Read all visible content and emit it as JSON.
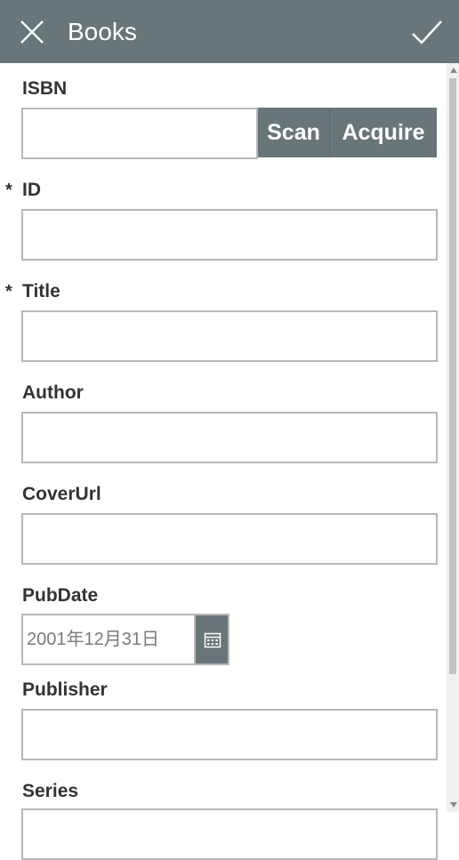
{
  "header": {
    "title": "Books"
  },
  "form": {
    "isbn": {
      "label": "ISBN",
      "value": "",
      "scan_label": "Scan",
      "acquire_label": "Acquire"
    },
    "id": {
      "label": "ID",
      "required_mark": "*",
      "value": ""
    },
    "title": {
      "label": "Title",
      "required_mark": "*",
      "value": ""
    },
    "author": {
      "label": "Author",
      "value": ""
    },
    "coverurl": {
      "label": "CoverUrl",
      "value": ""
    },
    "pubdate": {
      "label": "PubDate",
      "placeholder": "2001年12月31日"
    },
    "publisher": {
      "label": "Publisher",
      "value": ""
    },
    "series": {
      "label": "Series",
      "value": ""
    }
  },
  "colors": {
    "header_bg": "#68767a",
    "accent": "#68767a",
    "input_border": "#b8b8b8"
  },
  "icons": {
    "close": "close-icon",
    "confirm": "check-icon",
    "calendar": "calendar-icon"
  }
}
